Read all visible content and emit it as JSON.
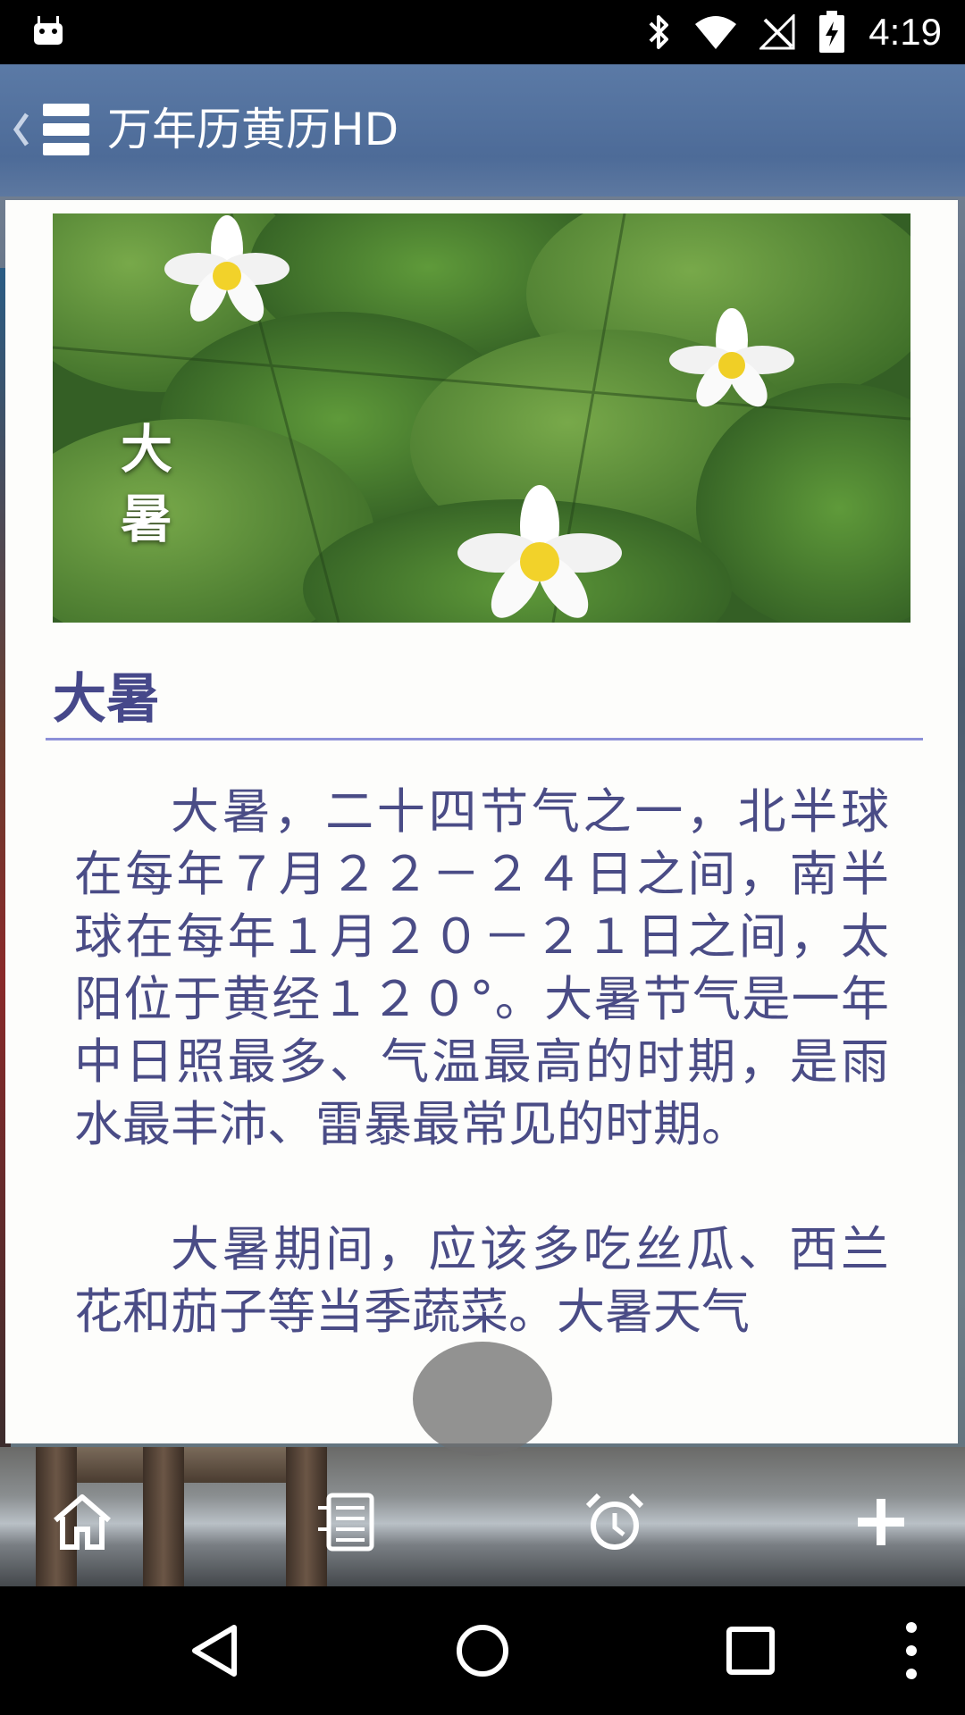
{
  "status_bar": {
    "time": "4:19",
    "icons": [
      "android-icon",
      "bluetooth-icon",
      "wifi-icon",
      "no-signal-icon",
      "battery-charging-icon"
    ]
  },
  "app_bar": {
    "title": "万年历黄历HD",
    "back_icon": "chevron-left-icon",
    "menu_icon": "menu-icon",
    "color": "#4f6d9a"
  },
  "article": {
    "image_caption_line1": "大",
    "image_caption_line2": "暑",
    "title": "大暑",
    "paragraphs": [
      "大暑，二十四节气之一，北半球在每年７月２２－２４日之间，南半球在每年１月２０－２１日之间，太阳位于黄经１２０°。大暑节气是一年中日照最多、气温最高的时期，是雨水最丰沛、雷暴最常见的时期。",
      "大暑期间，应该多吃丝瓜、西兰花和茄子等当季蔬菜。大暑天气"
    ],
    "title_color": "#46488a",
    "text_color": "#4a4c86",
    "divider_color": "#8c90d8"
  },
  "bottom_toolbar": {
    "items": [
      "home-icon",
      "list-icon",
      "alarm-clock-icon",
      "plus-icon"
    ]
  },
  "nav_bar": {
    "items": [
      "back-icon",
      "home-circle-icon",
      "recents-icon",
      "more-vert-icon"
    ]
  }
}
